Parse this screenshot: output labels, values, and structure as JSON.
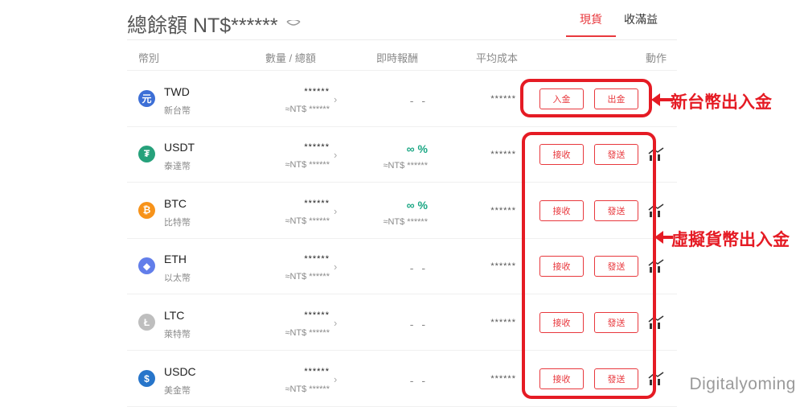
{
  "header": {
    "total_label": "總餘額 NT$******",
    "tabs": [
      {
        "label": "現貨",
        "active": true
      },
      {
        "label": "收滿益",
        "active": false
      }
    ]
  },
  "columns": {
    "currency": "幣別",
    "quantity": "數量 / 總額",
    "pnl": "即時報酬",
    "avg_cost": "平均成本",
    "action": "動作"
  },
  "rows": [
    {
      "symbol": "TWD",
      "name": "新台幣",
      "icon": "twd-icon",
      "icon_glyph": "元",
      "color": "#3d6fd6",
      "qty": "******",
      "qty_sub": "≈NT$ ******",
      "pnl": "- -",
      "pnl_sub": "",
      "avg": "******",
      "btn1": "入金",
      "btn2": "出金"
    },
    {
      "symbol": "USDT",
      "name": "泰達幣",
      "icon": "usdt-icon",
      "icon_glyph": "₮",
      "color": "#26a17b",
      "qty": "******",
      "qty_sub": "≈NT$ ******",
      "pnl": "∞ %",
      "pnl_sub": "≈NT$ ******",
      "avg": "******",
      "btn1": "接收",
      "btn2": "發送"
    },
    {
      "symbol": "BTC",
      "name": "比特幣",
      "icon": "btc-icon",
      "icon_glyph": "₿",
      "color": "#f7931a",
      "qty": "******",
      "qty_sub": "≈NT$ ******",
      "pnl": "∞ %",
      "pnl_sub": "≈NT$ ******",
      "avg": "******",
      "btn1": "接收",
      "btn2": "發送"
    },
    {
      "symbol": "ETH",
      "name": "以太幣",
      "icon": "eth-icon",
      "icon_glyph": "◆",
      "color": "#627eea",
      "qty": "******",
      "qty_sub": "≈NT$ ******",
      "pnl": "- -",
      "pnl_sub": "",
      "avg": "******",
      "btn1": "接收",
      "btn2": "發送"
    },
    {
      "symbol": "LTC",
      "name": "萊特幣",
      "icon": "ltc-icon",
      "icon_glyph": "Ł",
      "color": "#bebebe",
      "qty": "******",
      "qty_sub": "≈NT$ ******",
      "pnl": "- -",
      "pnl_sub": "",
      "avg": "******",
      "btn1": "接收",
      "btn2": "發送"
    },
    {
      "symbol": "USDC",
      "name": "美金幣",
      "icon": "usdc-icon",
      "icon_glyph": "$",
      "color": "#2775ca",
      "qty": "******",
      "qty_sub": "≈NT$ ******",
      "pnl": "- -",
      "pnl_sub": "",
      "avg": "******",
      "btn1": "接收",
      "btn2": "發送"
    }
  ],
  "annotations": {
    "fiat": "新台幣出入金",
    "crypto": "虛擬貨幣出入金",
    "accent": "#e51b24"
  },
  "watermark": "Digitalyoming"
}
